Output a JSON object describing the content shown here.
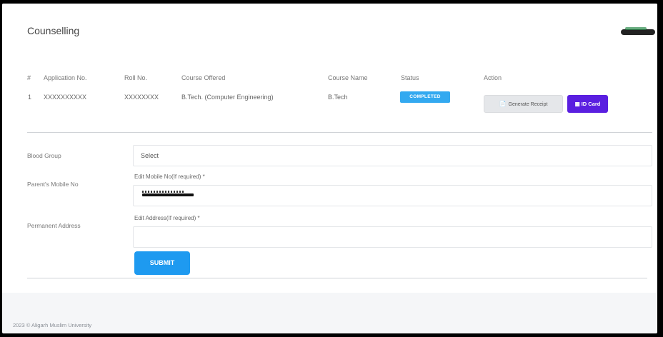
{
  "page": {
    "title": "Counselling"
  },
  "table": {
    "headers": [
      "#",
      "Application No.",
      "Roll No.",
      "Course Offered",
      "Course Name",
      "Status",
      "Action"
    ],
    "rows": [
      {
        "index": "1",
        "application_no": "XXXXXXXXXX",
        "roll_no": "XXXXXXXX",
        "course_offered": "B.Tech. (Computer Engineering)",
        "course_name": "B.Tech",
        "status": "COMPLETED"
      }
    ],
    "actions": {
      "receipt_label": "Generate Receipt",
      "idcard_label": "ID Card"
    }
  },
  "form": {
    "blood_group_label": "Blood Group",
    "blood_group_value": "Select",
    "parents_mobile_label": "Parent's Mobile No",
    "edit_mobile_hint": "Edit Mobile No(If required) *",
    "permanent_address_label": "Permanent Address",
    "edit_address_hint": "Edit Address(If required) *",
    "submit_label": "SUBMIT"
  },
  "footer": {
    "text": "2023 © Aligarh Muslim University"
  },
  "colors": {
    "status_badge": "#33a9f0",
    "idcard_button": "#5a1fe0",
    "submit_button": "#1e9af0"
  },
  "icons": {
    "receipt": "receipt-icon",
    "idcard": "id-card-icon"
  }
}
